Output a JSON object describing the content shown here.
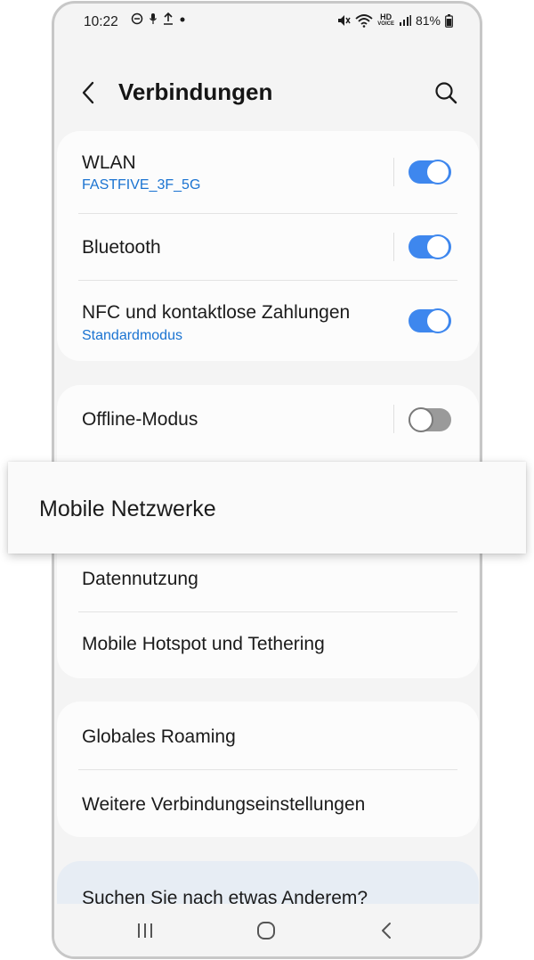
{
  "status_bar": {
    "time": "10:22",
    "battery": "81%",
    "hd_voice_top": "HD",
    "hd_voice_bottom": "VOICE"
  },
  "header": {
    "title": "Verbindungen"
  },
  "group1": {
    "wlan": {
      "title": "WLAN",
      "subtitle": "FASTFIVE_3F_5G",
      "on": true
    },
    "bluetooth": {
      "title": "Bluetooth",
      "on": true
    },
    "nfc": {
      "title": "NFC und kontaktlose Zahlungen",
      "subtitle": "Standardmodus",
      "on": true
    }
  },
  "group2": {
    "offline": {
      "title": "Offline-Modus",
      "on": false
    },
    "mobile_networks": {
      "title": "Mobile Netzwerke"
    },
    "data_usage": {
      "title": "Datennutzung"
    },
    "hotspot": {
      "title": "Mobile Hotspot und Tethering"
    }
  },
  "group3": {
    "roaming": {
      "title": "Globales Roaming"
    },
    "more": {
      "title": "Weitere Verbindungseinstellungen"
    }
  },
  "suggestion": {
    "text": "Suchen Sie nach etwas Anderem?"
  },
  "icons": {
    "back": "chevron-left-icon",
    "search": "search-icon",
    "recents": "recents-icon",
    "home": "home-icon",
    "nav_back": "nav-back-icon"
  },
  "colors": {
    "accent": "#3e87ee",
    "subtitle": "#1a73d1",
    "background": "#f4f4f4",
    "card": "#fcfcfc"
  }
}
